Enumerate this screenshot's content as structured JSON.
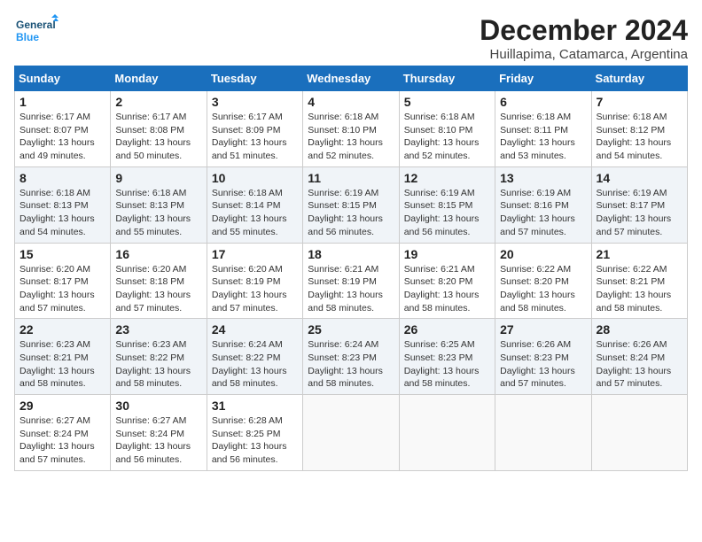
{
  "logo": {
    "line1": "General",
    "line2": "Blue"
  },
  "title": "December 2024",
  "subtitle": "Huillapima, Catamarca, Argentina",
  "weekdays": [
    "Sunday",
    "Monday",
    "Tuesday",
    "Wednesday",
    "Thursday",
    "Friday",
    "Saturday"
  ],
  "weeks": [
    [
      {
        "day": "1",
        "text": "Sunrise: 6:17 AM\nSunset: 8:07 PM\nDaylight: 13 hours\nand 49 minutes."
      },
      {
        "day": "2",
        "text": "Sunrise: 6:17 AM\nSunset: 8:08 PM\nDaylight: 13 hours\nand 50 minutes."
      },
      {
        "day": "3",
        "text": "Sunrise: 6:17 AM\nSunset: 8:09 PM\nDaylight: 13 hours\nand 51 minutes."
      },
      {
        "day": "4",
        "text": "Sunrise: 6:18 AM\nSunset: 8:10 PM\nDaylight: 13 hours\nand 52 minutes."
      },
      {
        "day": "5",
        "text": "Sunrise: 6:18 AM\nSunset: 8:10 PM\nDaylight: 13 hours\nand 52 minutes."
      },
      {
        "day": "6",
        "text": "Sunrise: 6:18 AM\nSunset: 8:11 PM\nDaylight: 13 hours\nand 53 minutes."
      },
      {
        "day": "7",
        "text": "Sunrise: 6:18 AM\nSunset: 8:12 PM\nDaylight: 13 hours\nand 54 minutes."
      }
    ],
    [
      {
        "day": "8",
        "text": "Sunrise: 6:18 AM\nSunset: 8:13 PM\nDaylight: 13 hours\nand 54 minutes."
      },
      {
        "day": "9",
        "text": "Sunrise: 6:18 AM\nSunset: 8:13 PM\nDaylight: 13 hours\nand 55 minutes."
      },
      {
        "day": "10",
        "text": "Sunrise: 6:18 AM\nSunset: 8:14 PM\nDaylight: 13 hours\nand 55 minutes."
      },
      {
        "day": "11",
        "text": "Sunrise: 6:19 AM\nSunset: 8:15 PM\nDaylight: 13 hours\nand 56 minutes."
      },
      {
        "day": "12",
        "text": "Sunrise: 6:19 AM\nSunset: 8:15 PM\nDaylight: 13 hours\nand 56 minutes."
      },
      {
        "day": "13",
        "text": "Sunrise: 6:19 AM\nSunset: 8:16 PM\nDaylight: 13 hours\nand 57 minutes."
      },
      {
        "day": "14",
        "text": "Sunrise: 6:19 AM\nSunset: 8:17 PM\nDaylight: 13 hours\nand 57 minutes."
      }
    ],
    [
      {
        "day": "15",
        "text": "Sunrise: 6:20 AM\nSunset: 8:17 PM\nDaylight: 13 hours\nand 57 minutes."
      },
      {
        "day": "16",
        "text": "Sunrise: 6:20 AM\nSunset: 8:18 PM\nDaylight: 13 hours\nand 57 minutes."
      },
      {
        "day": "17",
        "text": "Sunrise: 6:20 AM\nSunset: 8:19 PM\nDaylight: 13 hours\nand 57 minutes."
      },
      {
        "day": "18",
        "text": "Sunrise: 6:21 AM\nSunset: 8:19 PM\nDaylight: 13 hours\nand 58 minutes."
      },
      {
        "day": "19",
        "text": "Sunrise: 6:21 AM\nSunset: 8:20 PM\nDaylight: 13 hours\nand 58 minutes."
      },
      {
        "day": "20",
        "text": "Sunrise: 6:22 AM\nSunset: 8:20 PM\nDaylight: 13 hours\nand 58 minutes."
      },
      {
        "day": "21",
        "text": "Sunrise: 6:22 AM\nSunset: 8:21 PM\nDaylight: 13 hours\nand 58 minutes."
      }
    ],
    [
      {
        "day": "22",
        "text": "Sunrise: 6:23 AM\nSunset: 8:21 PM\nDaylight: 13 hours\nand 58 minutes."
      },
      {
        "day": "23",
        "text": "Sunrise: 6:23 AM\nSunset: 8:22 PM\nDaylight: 13 hours\nand 58 minutes."
      },
      {
        "day": "24",
        "text": "Sunrise: 6:24 AM\nSunset: 8:22 PM\nDaylight: 13 hours\nand 58 minutes."
      },
      {
        "day": "25",
        "text": "Sunrise: 6:24 AM\nSunset: 8:23 PM\nDaylight: 13 hours\nand 58 minutes."
      },
      {
        "day": "26",
        "text": "Sunrise: 6:25 AM\nSunset: 8:23 PM\nDaylight: 13 hours\nand 58 minutes."
      },
      {
        "day": "27",
        "text": "Sunrise: 6:26 AM\nSunset: 8:23 PM\nDaylight: 13 hours\nand 57 minutes."
      },
      {
        "day": "28",
        "text": "Sunrise: 6:26 AM\nSunset: 8:24 PM\nDaylight: 13 hours\nand 57 minutes."
      }
    ],
    [
      {
        "day": "29",
        "text": "Sunrise: 6:27 AM\nSunset: 8:24 PM\nDaylight: 13 hours\nand 57 minutes."
      },
      {
        "day": "30",
        "text": "Sunrise: 6:27 AM\nSunset: 8:24 PM\nDaylight: 13 hours\nand 56 minutes."
      },
      {
        "day": "31",
        "text": "Sunrise: 6:28 AM\nSunset: 8:25 PM\nDaylight: 13 hours\nand 56 minutes."
      },
      null,
      null,
      null,
      null
    ]
  ]
}
